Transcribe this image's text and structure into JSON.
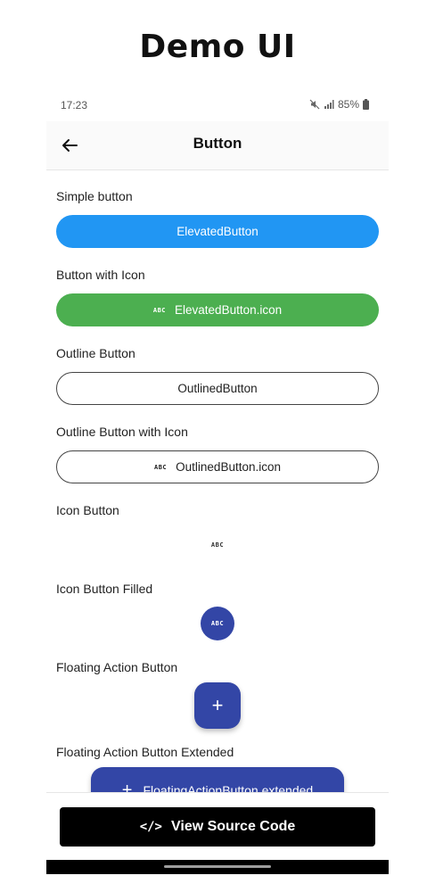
{
  "page_title": "Demo UI",
  "status_bar": {
    "time": "17:23",
    "battery": "85%"
  },
  "app_bar": {
    "title": "Button"
  },
  "sections": {
    "simple": {
      "label": "Simple button",
      "button": "ElevatedButton"
    },
    "icon": {
      "label": "Button with Icon",
      "button": "ElevatedButton.icon",
      "icon_text": "ABC"
    },
    "outline": {
      "label": "Outline Button",
      "button": "OutlinedButton"
    },
    "outline_icon": {
      "label": "Outline Button with Icon",
      "button": "OutlinedButton.icon",
      "icon_text": "ABC"
    },
    "icon_button": {
      "label": "Icon Button",
      "icon_text": "ABC"
    },
    "icon_button_filled": {
      "label": "Icon Button Filled",
      "icon_text": "ABC"
    },
    "fab": {
      "label": "Floating Action Button",
      "icon": "+"
    },
    "fab_extended": {
      "label": "Floating Action Button Extended",
      "icon": "+",
      "button": "FloatingActionButton.extended"
    }
  },
  "footer": {
    "source_button": "View Source Code",
    "source_icon": "</>"
  },
  "colors": {
    "elevated_blue": "#2196f3",
    "elevated_green": "#4caf50",
    "indigo": "#3346a6"
  },
  "icons": [
    "back-arrow-icon",
    "mute-icon",
    "signal-icon",
    "battery-icon",
    "abc-icon",
    "plus-icon",
    "code-icon"
  ]
}
